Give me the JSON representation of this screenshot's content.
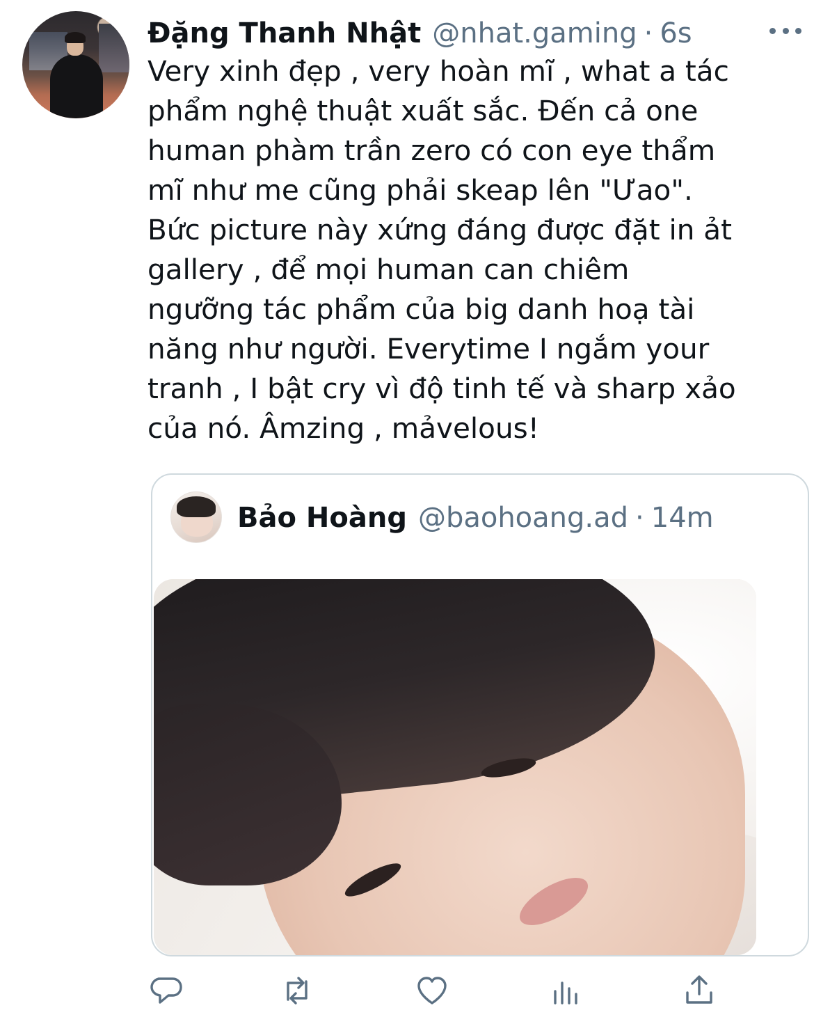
{
  "tweet": {
    "author_name": "Đặng Thanh Nhật",
    "author_handle": "@nhat.gaming",
    "separator": "·",
    "time": "6s",
    "text": "Very xinh đẹp , very hoàn mĩ , what a tác\nphẩm nghệ thuật xuất sắc. Đến cả one\nhuman phàm trần zero có con eye thẩm\nmĩ như me cũng phải skeap lên \"Ưao\".\nBức picture này xứng đáng được đặt in ảt\ngallery , để mọi human can chiêm\nngưỡng tác phẩm của big danh hoạ tài\nnăng như người. Everytime I ngắm your\ntranh , I bật cry vì độ tinh tế và sharp xảo\ncủa nó. Âmzing ,  mảvelous!"
  },
  "quoted": {
    "author_name": "Bảo Hoàng",
    "author_handle": "@baohoang.ad",
    "separator": "·",
    "time": "14m"
  },
  "icons": {
    "more": "more-horizontal-icon",
    "reply": "reply-icon",
    "retweet": "retweet-icon",
    "like": "heart-icon",
    "analytics": "analytics-icon",
    "share": "share-icon"
  },
  "colors": {
    "text": "#0f1419",
    "secondary": "#5b7083",
    "border": "#cfd9de"
  }
}
